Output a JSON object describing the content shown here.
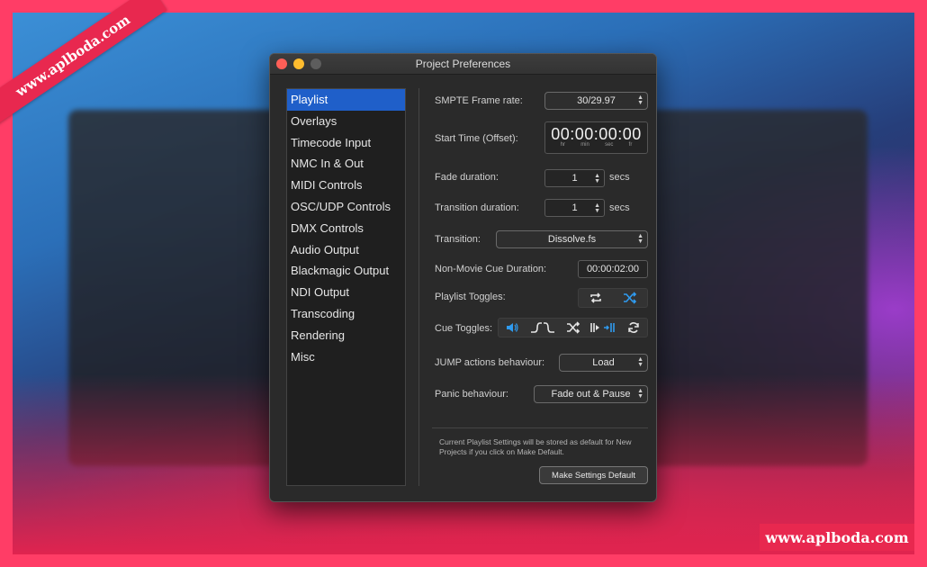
{
  "window": {
    "title": "Project Preferences"
  },
  "sidebar": {
    "items": [
      {
        "label": "Playlist",
        "active": true
      },
      {
        "label": "Overlays"
      },
      {
        "label": "Timecode Input"
      },
      {
        "label": "NMC In & Out"
      },
      {
        "label": "MIDI Controls"
      },
      {
        "label": "OSC/UDP Controls"
      },
      {
        "label": "DMX Controls"
      },
      {
        "label": "Audio Output"
      },
      {
        "label": "Blackmagic Output"
      },
      {
        "label": "NDI Output"
      },
      {
        "label": "Transcoding"
      },
      {
        "label": "Rendering"
      },
      {
        "label": "Misc"
      }
    ]
  },
  "settings": {
    "smpte_label": "SMPTE Frame rate:",
    "smpte_value": "30/29.97",
    "start_time_label": "Start Time (Offset):",
    "start_time_value": "00:00:00:00",
    "start_time_units": [
      "hr",
      "min",
      "sec",
      "fr"
    ],
    "fade_label": "Fade duration:",
    "fade_value": "1",
    "fade_unit": "secs",
    "transition_duration_label": "Transition duration:",
    "transition_duration_value": "1",
    "transition_duration_unit": "secs",
    "transition_label": "Transition:",
    "transition_value": "Dissolve.fs",
    "non_movie_label": "Non-Movie Cue Duration:",
    "non_movie_value": "00:00:02:00",
    "playlist_toggles_label": "Playlist Toggles:",
    "cue_toggles_label": "Cue Toggles:",
    "jump_label": "JUMP actions behaviour:",
    "jump_value": "Load",
    "panic_label": "Panic behaviour:",
    "panic_value": "Fade out & Pause"
  },
  "footer": {
    "note": "Current Playlist Settings will be stored as default for New Projects if you click on Make Default.",
    "make_default_label": "Make Settings Default"
  },
  "watermark": {
    "ribbon": "www.aplboda.com",
    "box": "www.aplboda.com"
  },
  "colors": {
    "accent_blue": "#1f5fc9",
    "toggle_blue": "#2f9bf0",
    "frame_pink": "#ff3d66"
  },
  "icons": {
    "playlist_toggles": [
      "repeat-icon",
      "shuffle-icon"
    ],
    "cue_toggles": [
      "speaker-icon",
      "fade-icon",
      "shuffle-icon",
      "skip-icon",
      "loop-icon"
    ]
  }
}
